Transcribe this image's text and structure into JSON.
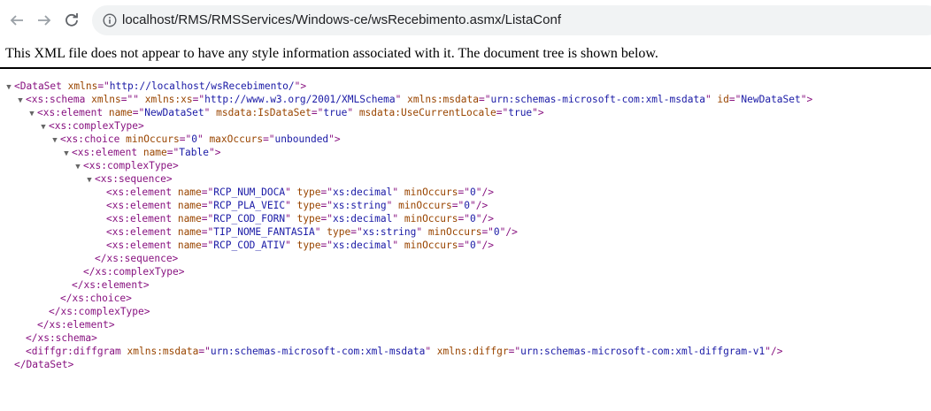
{
  "browser": {
    "url": "localhost/RMS/RMSServices/Windows-ce/wsRecebimento.asmx/ListaConf"
  },
  "banner": {
    "text": "This XML file does not appear to have any style information associated with it. The document tree is shown below."
  },
  "xml_lines": [
    {
      "indent": 0,
      "toggle": true,
      "tokens": [
        {
          "t": "tag",
          "v": "<DataSet"
        },
        {
          "t": "an",
          "v": " xmlns"
        },
        {
          "t": "tag",
          "v": "=\""
        },
        {
          "t": "av",
          "v": "http://localhost/wsRecebimento/"
        },
        {
          "t": "tag",
          "v": "\">"
        }
      ]
    },
    {
      "indent": 1,
      "toggle": true,
      "tokens": [
        {
          "t": "tag",
          "v": "<xs:schema"
        },
        {
          "t": "an",
          "v": " xmlns"
        },
        {
          "t": "tag",
          "v": "=\"\""
        },
        {
          "t": "an",
          "v": " xmlns:xs"
        },
        {
          "t": "tag",
          "v": "=\""
        },
        {
          "t": "av",
          "v": "http://www.w3.org/2001/XMLSchema"
        },
        {
          "t": "tag",
          "v": "\""
        },
        {
          "t": "an",
          "v": " xmlns:msdata"
        },
        {
          "t": "tag",
          "v": "=\""
        },
        {
          "t": "av",
          "v": "urn:schemas-microsoft-com:xml-msdata"
        },
        {
          "t": "tag",
          "v": "\""
        },
        {
          "t": "an",
          "v": " id"
        },
        {
          "t": "tag",
          "v": "=\""
        },
        {
          "t": "av",
          "v": "NewDataSet"
        },
        {
          "t": "tag",
          "v": "\">"
        }
      ]
    },
    {
      "indent": 2,
      "toggle": true,
      "tokens": [
        {
          "t": "tag",
          "v": "<xs:element"
        },
        {
          "t": "an",
          "v": " name"
        },
        {
          "t": "tag",
          "v": "=\""
        },
        {
          "t": "av",
          "v": "NewDataSet"
        },
        {
          "t": "tag",
          "v": "\""
        },
        {
          "t": "an",
          "v": " msdata:IsDataSet"
        },
        {
          "t": "tag",
          "v": "=\""
        },
        {
          "t": "av",
          "v": "true"
        },
        {
          "t": "tag",
          "v": "\""
        },
        {
          "t": "an",
          "v": " msdata:UseCurrentLocale"
        },
        {
          "t": "tag",
          "v": "=\""
        },
        {
          "t": "av",
          "v": "true"
        },
        {
          "t": "tag",
          "v": "\">"
        }
      ]
    },
    {
      "indent": 3,
      "toggle": true,
      "tokens": [
        {
          "t": "tag",
          "v": "<xs:complexType>"
        }
      ]
    },
    {
      "indent": 4,
      "toggle": true,
      "tokens": [
        {
          "t": "tag",
          "v": "<xs:choice"
        },
        {
          "t": "an",
          "v": " minOccurs"
        },
        {
          "t": "tag",
          "v": "=\""
        },
        {
          "t": "av",
          "v": "0"
        },
        {
          "t": "tag",
          "v": "\""
        },
        {
          "t": "an",
          "v": " maxOccurs"
        },
        {
          "t": "tag",
          "v": "=\""
        },
        {
          "t": "av",
          "v": "unbounded"
        },
        {
          "t": "tag",
          "v": "\">"
        }
      ]
    },
    {
      "indent": 5,
      "toggle": true,
      "tokens": [
        {
          "t": "tag",
          "v": "<xs:element"
        },
        {
          "t": "an",
          "v": " name"
        },
        {
          "t": "tag",
          "v": "=\""
        },
        {
          "t": "av",
          "v": "Table"
        },
        {
          "t": "tag",
          "v": "\">"
        }
      ]
    },
    {
      "indent": 6,
      "toggle": true,
      "tokens": [
        {
          "t": "tag",
          "v": "<xs:complexType>"
        }
      ]
    },
    {
      "indent": 7,
      "toggle": true,
      "tokens": [
        {
          "t": "tag",
          "v": "<xs:sequence>"
        }
      ]
    },
    {
      "indent": 8,
      "toggle": false,
      "tokens": [
        {
          "t": "tag",
          "v": "<xs:element"
        },
        {
          "t": "an",
          "v": " name"
        },
        {
          "t": "tag",
          "v": "=\""
        },
        {
          "t": "av",
          "v": "RCP_NUM_DOCA"
        },
        {
          "t": "tag",
          "v": "\""
        },
        {
          "t": "an",
          "v": " type"
        },
        {
          "t": "tag",
          "v": "=\""
        },
        {
          "t": "av",
          "v": "xs:decimal"
        },
        {
          "t": "tag",
          "v": "\""
        },
        {
          "t": "an",
          "v": " minOccurs"
        },
        {
          "t": "tag",
          "v": "=\""
        },
        {
          "t": "av",
          "v": "0"
        },
        {
          "t": "tag",
          "v": "\"/>"
        }
      ]
    },
    {
      "indent": 8,
      "toggle": false,
      "tokens": [
        {
          "t": "tag",
          "v": "<xs:element"
        },
        {
          "t": "an",
          "v": " name"
        },
        {
          "t": "tag",
          "v": "=\""
        },
        {
          "t": "av",
          "v": "RCP_PLA_VEIC"
        },
        {
          "t": "tag",
          "v": "\""
        },
        {
          "t": "an",
          "v": " type"
        },
        {
          "t": "tag",
          "v": "=\""
        },
        {
          "t": "av",
          "v": "xs:string"
        },
        {
          "t": "tag",
          "v": "\""
        },
        {
          "t": "an",
          "v": " minOccurs"
        },
        {
          "t": "tag",
          "v": "=\""
        },
        {
          "t": "av",
          "v": "0"
        },
        {
          "t": "tag",
          "v": "\"/>"
        }
      ]
    },
    {
      "indent": 8,
      "toggle": false,
      "tokens": [
        {
          "t": "tag",
          "v": "<xs:element"
        },
        {
          "t": "an",
          "v": " name"
        },
        {
          "t": "tag",
          "v": "=\""
        },
        {
          "t": "av",
          "v": "RCP_COD_FORN"
        },
        {
          "t": "tag",
          "v": "\""
        },
        {
          "t": "an",
          "v": " type"
        },
        {
          "t": "tag",
          "v": "=\""
        },
        {
          "t": "av",
          "v": "xs:decimal"
        },
        {
          "t": "tag",
          "v": "\""
        },
        {
          "t": "an",
          "v": " minOccurs"
        },
        {
          "t": "tag",
          "v": "=\""
        },
        {
          "t": "av",
          "v": "0"
        },
        {
          "t": "tag",
          "v": "\"/>"
        }
      ]
    },
    {
      "indent": 8,
      "toggle": false,
      "tokens": [
        {
          "t": "tag",
          "v": "<xs:element"
        },
        {
          "t": "an",
          "v": " name"
        },
        {
          "t": "tag",
          "v": "=\""
        },
        {
          "t": "av",
          "v": "TIP_NOME_FANTASIA"
        },
        {
          "t": "tag",
          "v": "\""
        },
        {
          "t": "an",
          "v": " type"
        },
        {
          "t": "tag",
          "v": "=\""
        },
        {
          "t": "av",
          "v": "xs:string"
        },
        {
          "t": "tag",
          "v": "\""
        },
        {
          "t": "an",
          "v": " minOccurs"
        },
        {
          "t": "tag",
          "v": "=\""
        },
        {
          "t": "av",
          "v": "0"
        },
        {
          "t": "tag",
          "v": "\"/>"
        }
      ]
    },
    {
      "indent": 8,
      "toggle": false,
      "tokens": [
        {
          "t": "tag",
          "v": "<xs:element"
        },
        {
          "t": "an",
          "v": " name"
        },
        {
          "t": "tag",
          "v": "=\""
        },
        {
          "t": "av",
          "v": "RCP_COD_ATIV"
        },
        {
          "t": "tag",
          "v": "\""
        },
        {
          "t": "an",
          "v": " type"
        },
        {
          "t": "tag",
          "v": "=\""
        },
        {
          "t": "av",
          "v": "xs:decimal"
        },
        {
          "t": "tag",
          "v": "\""
        },
        {
          "t": "an",
          "v": " minOccurs"
        },
        {
          "t": "tag",
          "v": "=\""
        },
        {
          "t": "av",
          "v": "0"
        },
        {
          "t": "tag",
          "v": "\"/>"
        }
      ]
    },
    {
      "indent": 7,
      "toggle": false,
      "tokens": [
        {
          "t": "tag",
          "v": "</xs:sequence>"
        }
      ]
    },
    {
      "indent": 6,
      "toggle": false,
      "tokens": [
        {
          "t": "tag",
          "v": "</xs:complexType>"
        }
      ]
    },
    {
      "indent": 5,
      "toggle": false,
      "tokens": [
        {
          "t": "tag",
          "v": "</xs:element>"
        }
      ]
    },
    {
      "indent": 4,
      "toggle": false,
      "tokens": [
        {
          "t": "tag",
          "v": "</xs:choice>"
        }
      ]
    },
    {
      "indent": 3,
      "toggle": false,
      "tokens": [
        {
          "t": "tag",
          "v": "</xs:complexType>"
        }
      ]
    },
    {
      "indent": 2,
      "toggle": false,
      "tokens": [
        {
          "t": "tag",
          "v": "</xs:element>"
        }
      ]
    },
    {
      "indent": 1,
      "toggle": false,
      "tokens": [
        {
          "t": "tag",
          "v": "</xs:schema>"
        }
      ]
    },
    {
      "indent": 1,
      "toggle": false,
      "tokens": [
        {
          "t": "tag",
          "v": "<diffgr:diffgram"
        },
        {
          "t": "an",
          "v": " xmlns:msdata"
        },
        {
          "t": "tag",
          "v": "=\""
        },
        {
          "t": "av",
          "v": "urn:schemas-microsoft-com:xml-msdata"
        },
        {
          "t": "tag",
          "v": "\""
        },
        {
          "t": "an",
          "v": " xmlns:diffgr"
        },
        {
          "t": "tag",
          "v": "=\""
        },
        {
          "t": "av",
          "v": "urn:schemas-microsoft-com:xml-diffgram-v1"
        },
        {
          "t": "tag",
          "v": "\"/>"
        }
      ]
    },
    {
      "indent": 0,
      "toggle": false,
      "tokens": [
        {
          "t": "tag",
          "v": "</DataSet>"
        }
      ]
    }
  ]
}
